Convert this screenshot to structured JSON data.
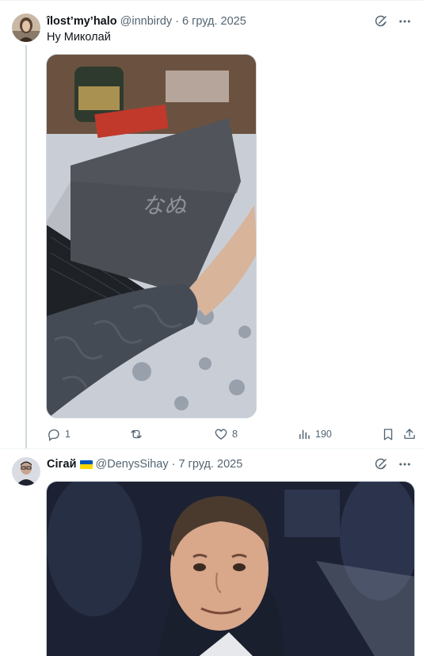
{
  "tweets": [
    {
      "display_name": "îlost’my’halo",
      "handle": "@innbirdy",
      "separator": "·",
      "date": "6 груд. 2025",
      "text": "Ну Миколай",
      "media_icon": "laptop-photo",
      "stats": {
        "replies": "1",
        "retweets": "",
        "likes": "8",
        "views": "190"
      }
    },
    {
      "display_name": "Сігай",
      "flag": "ukraine-flag",
      "handle": "@DenysSihay",
      "separator": "·",
      "date": "7 груд. 2025",
      "media_icon": "man-portrait-photo"
    }
  ],
  "icons": {
    "grok": "grok-icon",
    "more": "more-icon",
    "reply": "reply-icon",
    "retweet": "retweet-icon",
    "like": "heart-icon",
    "views": "views-icon",
    "bookmark": "bookmark-icon",
    "share": "share-icon"
  },
  "colors": {
    "secondary_text": "#536471",
    "border": "#eff3f4",
    "thread_line": "#cfd9de"
  }
}
